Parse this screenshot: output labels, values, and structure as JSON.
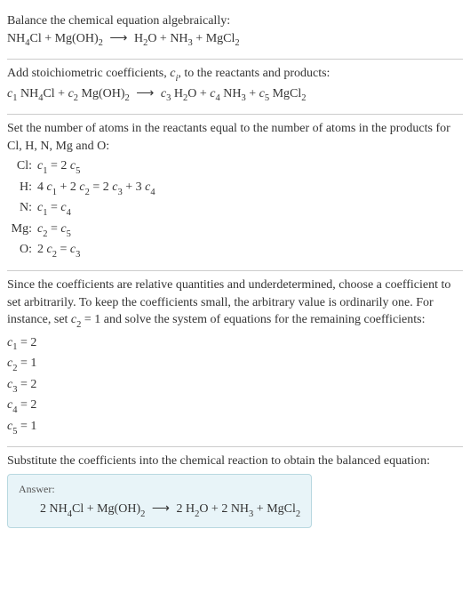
{
  "section1": {
    "intro": "Balance the chemical equation algebraically:",
    "eq_lhs1": "NH",
    "eq_sub1": "4",
    "eq_mid1": "Cl + Mg(OH)",
    "eq_sub2": "2",
    "arrow": "⟶",
    "eq_rhs1": "H",
    "eq_sub3": "2",
    "eq_rhs2": "O + NH",
    "eq_sub4": "3",
    "eq_rhs3": " + MgCl",
    "eq_sub5": "2"
  },
  "section2": {
    "intro_a": "Add stoichiometric coefficients, ",
    "ci": "c",
    "ci_sub": "i",
    "intro_b": ", to the reactants and products:",
    "c1": "c",
    "s1": "1",
    "t1": " NH",
    "s1b": "4",
    "t2": "Cl + ",
    "c2": "c",
    "s2": "2",
    "t3": " Mg(OH)",
    "s2b": "2",
    "arrow": "⟶",
    "c3": "c",
    "s3": "3",
    "t4": " H",
    "s3b": "2",
    "t5": "O + ",
    "c4": "c",
    "s4": "4",
    "t6": " NH",
    "s4b": "3",
    "t7": " + ",
    "c5": "c",
    "s5": "5",
    "t8": " MgCl",
    "s5b": "2"
  },
  "section3": {
    "intro": "Set the number of atoms in the reactants equal to the number of atoms in the products for Cl, H, N, Mg and O:",
    "rows": [
      {
        "label": "Cl:",
        "lhs_c": "c",
        "lhs_s": "1",
        "mid": " = 2 ",
        "rhs_c": "c",
        "rhs_s": "5"
      },
      {
        "label": "H:",
        "pre": "4 ",
        "c1": "c",
        "s1": "1",
        "mid1": " + 2 ",
        "c2": "c",
        "s2": "2",
        "mid2": " = 2 ",
        "c3": "c",
        "s3": "3",
        "mid3": " + 3 ",
        "c4": "c",
        "s4": "4"
      },
      {
        "label": "N:",
        "lhs_c": "c",
        "lhs_s": "1",
        "mid": " = ",
        "rhs_c": "c",
        "rhs_s": "4"
      },
      {
        "label": "Mg:",
        "lhs_c": "c",
        "lhs_s": "2",
        "mid": " = ",
        "rhs_c": "c",
        "rhs_s": "5"
      },
      {
        "label": "O:",
        "pre": "2 ",
        "lhs_c": "c",
        "lhs_s": "2",
        "mid": " = ",
        "rhs_c": "c",
        "rhs_s": "3"
      }
    ]
  },
  "section4": {
    "intro_a": "Since the coefficients are relative quantities and underdetermined, choose a coefficient to set arbitrarily. To keep the coefficients small, the arbitrary value is ordinarily one. For instance, set ",
    "c2": "c",
    "s2": "2",
    "intro_b": " = 1 and solve the system of equations for the remaining coefficients:",
    "coeffs": [
      {
        "c": "c",
        "s": "1",
        "v": " = 2"
      },
      {
        "c": "c",
        "s": "2",
        "v": " = 1"
      },
      {
        "c": "c",
        "s": "3",
        "v": " = 2"
      },
      {
        "c": "c",
        "s": "4",
        "v": " = 2"
      },
      {
        "c": "c",
        "s": "5",
        "v": " = 1"
      }
    ]
  },
  "section5": {
    "intro": "Substitute the coefficients into the chemical reaction to obtain the balanced equation:",
    "answer_label": "Answer:",
    "eq_pre": "2 NH",
    "s1": "4",
    "t1": "Cl + Mg(OH)",
    "s2": "2",
    "arrow": "⟶",
    "t2": "2 H",
    "s3": "2",
    "t3": "O + 2 NH",
    "s4": "3",
    "t4": " + MgCl",
    "s5": "2"
  }
}
